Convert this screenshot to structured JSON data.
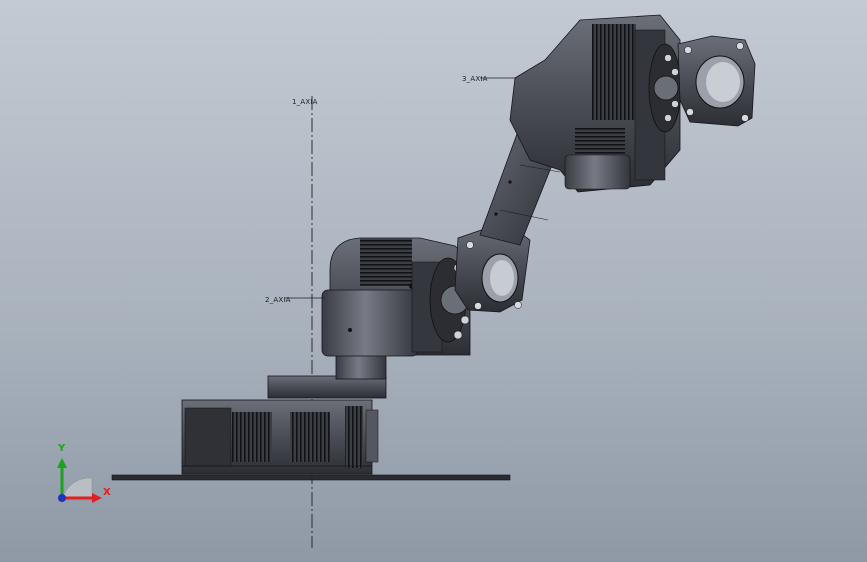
{
  "window": {
    "title": "",
    "background_top": "#c3cad3",
    "background_bottom": "#8f99a6"
  },
  "annotations": {
    "axis_top": "1_AXIA",
    "axis_middle": "2_AXIA",
    "axis_upper_right": "3_AXIA"
  },
  "triad": {
    "x_label": "X",
    "y_label": "Y",
    "x_color": "#e02020",
    "y_color": "#20a020",
    "z_color": "#2030c0"
  },
  "model": {
    "body_color": "#4a4d55",
    "highlight_color": "#8e929b",
    "shadow_color": "#202228"
  }
}
